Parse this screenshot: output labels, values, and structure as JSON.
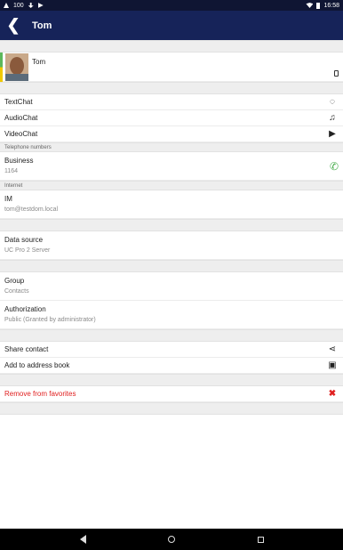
{
  "status_bar": {
    "left_text": "100",
    "time": "16:58"
  },
  "header": {
    "back_glyph": "❮",
    "title": "Tom"
  },
  "contact": {
    "name": "Tom"
  },
  "chat": [
    {
      "label": "TextChat",
      "icon": "text-chat-icon",
      "glyph": "◌"
    },
    {
      "label": "AudioChat",
      "icon": "headset-icon",
      "glyph": "♫"
    },
    {
      "label": "VideoChat",
      "icon": "video-play-icon",
      "glyph": "▶"
    }
  ],
  "telephone": {
    "section_label": "Telephone numbers",
    "type": "Business",
    "number": "1164",
    "phone_glyph": "✆"
  },
  "internet": {
    "section_label": "Internet",
    "label": "IM",
    "value": "tom@testdom.local"
  },
  "data_source": {
    "label": "Data source",
    "value": "UC Pro 2 Server"
  },
  "group": {
    "label": "Group",
    "value": "Contacts"
  },
  "authorization": {
    "label": "Authorization",
    "value": "Public (Granted by administrator)"
  },
  "actions": [
    {
      "label": "Share contact",
      "glyph": "⋖"
    },
    {
      "label": "Add to address book",
      "glyph": "▣"
    }
  ],
  "favorites": {
    "label": "Remove from favorites",
    "glyph": "✖"
  },
  "colors": {
    "appbar": "#162359",
    "statusbar": "#0f1533",
    "danger": "#e02020",
    "phone": "#4caf50"
  }
}
